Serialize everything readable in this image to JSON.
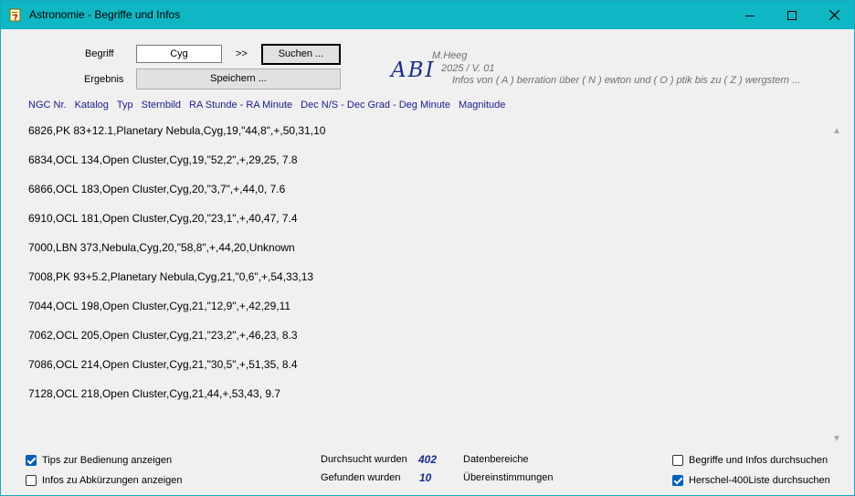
{
  "window": {
    "title": "Astronomie - Begriffe und Infos"
  },
  "search": {
    "term_label": "Begriff",
    "term_value": "Cyg",
    "arrows": ">>",
    "search_button": "Suchen ...",
    "result_label": "Ergebnis",
    "save_button": "Speichern ..."
  },
  "branding": {
    "logo": "ABI",
    "author": "M.Heeg",
    "version": "2025 / V. 01",
    "tagline": "Infos von ( A ) berration über ( N ) ewton und ( O ) ptik bis zu ( Z ) wergstern ..."
  },
  "columns": [
    "NGC Nr.",
    "Katalog",
    "Typ",
    "Sternbild",
    "RA Stunde - RA Minute",
    "Dec N/S - Dec Grad - Deg Minute",
    "Magnitude"
  ],
  "results": [
    "6826,PK 83+12.1,Planetary Nebula,Cyg,19,\"44,8\",+,50,31,10",
    "6834,OCL 134,Open Cluster,Cyg,19,\"52,2\",+,29,25, 7.8",
    "6866,OCL 183,Open Cluster,Cyg,20,\"3,7\",+,44,0, 7.6",
    "6910,OCL 181,Open Cluster,Cyg,20,\"23,1\",+,40,47, 7.4",
    "7000,LBN 373,Nebula,Cyg,20,\"58,8\",+,44,20,Unknown",
    "7008,PK 93+5.2,Planetary Nebula,Cyg,21,\"0,6\",+,54,33,13",
    "7044,OCL 198,Open Cluster,Cyg,21,\"12,9\",+,42,29,11",
    "7062,OCL 205,Open Cluster,Cyg,21,\"23,2\",+,46,23, 8.3",
    "7086,OCL 214,Open Cluster,Cyg,21,\"30,5\",+,51,35, 8.4",
    "7128,OCL 218,Open Cluster,Cyg,21,44,+,53,43, 9.7"
  ],
  "options": {
    "tips_label": "Tips zur Bedienung anzeigen",
    "tips_checked": true,
    "abbrev_label": "Infos zu Abkürzungen anzeigen",
    "abbrev_checked": false,
    "terms_label": "Begriffe und Infos durchsuchen",
    "terms_checked": false,
    "herschel_label": "Herschel-400Liste durchsuchen",
    "herschel_checked": true
  },
  "stats": {
    "searched_label": "Durchsucht wurden",
    "searched_value": "402",
    "searched_unit": "Datenbereiche",
    "found_label": "Gefunden wurden",
    "found_value": "10",
    "found_unit": "Übereinstimmungen"
  },
  "colors": {
    "titlebar": "#0fb7c4",
    "accent": "#005fb8",
    "header_text": "#1a1a8c"
  }
}
